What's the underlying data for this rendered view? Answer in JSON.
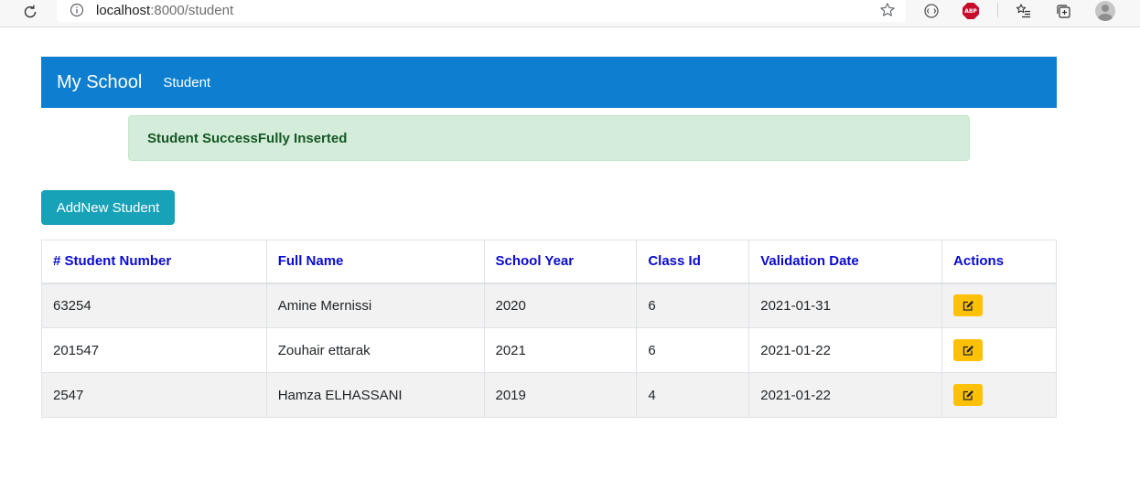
{
  "browser": {
    "url_host": "localhost",
    "url_rest": ":8000/student",
    "icons": [
      "reload-icon",
      "info-icon",
      "star-icon",
      "extension-icon",
      "adblock-icon",
      "favorites-icon",
      "collections-icon",
      "profile-icon"
    ],
    "adblock_label": "ABP"
  },
  "navbar": {
    "brand": "My School",
    "links": [
      "Student"
    ],
    "color": "#0e7fd0"
  },
  "alert": {
    "message": "Student SuccessFully Inserted",
    "color": "#d4edda"
  },
  "add_button": {
    "label": "AddNew Student",
    "color": "#17a2b8"
  },
  "table": {
    "headers": [
      "# Student Number",
      "Full Name",
      "School Year",
      "Class Id",
      "Validation Date",
      "Actions"
    ],
    "header_color": "#0a0acf",
    "rows": [
      [
        "63254",
        "Amine Mernissi",
        "2020",
        "6",
        "2021-01-31"
      ],
      [
        "201547",
        "Zouhair ettarak",
        "2021",
        "6",
        "2021-01-22"
      ],
      [
        "2547",
        "Hamza ELHASSANI",
        "2019",
        "4",
        "2021-01-22"
      ]
    ],
    "action_icon": "edit-icon",
    "action_color": "#ffc107"
  }
}
